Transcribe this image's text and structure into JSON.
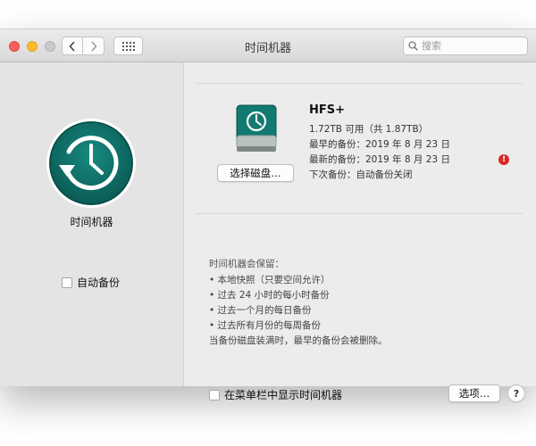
{
  "window": {
    "title": "时间机器"
  },
  "toolbar": {
    "back_icon": "chevron-left-icon",
    "forward_icon": "chevron-right-icon",
    "grid_icon": "grid-icon",
    "search_placeholder": "搜索"
  },
  "sidebar": {
    "logo_icon": "time-machine-icon",
    "title": "时间机器",
    "auto_backup_label": "自动备份",
    "auto_backup_checked": false
  },
  "disk": {
    "icon": "external-drive-icon",
    "select_button": "选择磁盘…",
    "name": "HFS+",
    "available": "1.72TB 可用（共 1.87TB）",
    "oldest_backup": "最早的备份：2019 年 8 月 23 日",
    "latest_backup": "最新的备份：2019 年 8 月 23 日",
    "next_backup": "下次备份：自动备份关闭",
    "warning_badge": "!"
  },
  "retention": {
    "title": "时间机器会保留：",
    "items": [
      "• 本地快照（只要空间允许）",
      "• 过去 24 小时的每小时备份",
      "• 过去一个月的每日备份",
      "• 过去所有月份的每周备份"
    ],
    "note": "当备份磁盘装满时，最早的备份会被删除。"
  },
  "footer": {
    "menubar_label": "在菜单栏中显示时间机器",
    "menubar_checked": false,
    "options_button": "选项…",
    "help_button": "?"
  },
  "colors": {
    "close": "#fc5f57",
    "minimize": "#fdbc2e",
    "maximize": "#c9c9c9",
    "time_machine_teal": "#0d6a62",
    "warning": "#d52b26"
  }
}
